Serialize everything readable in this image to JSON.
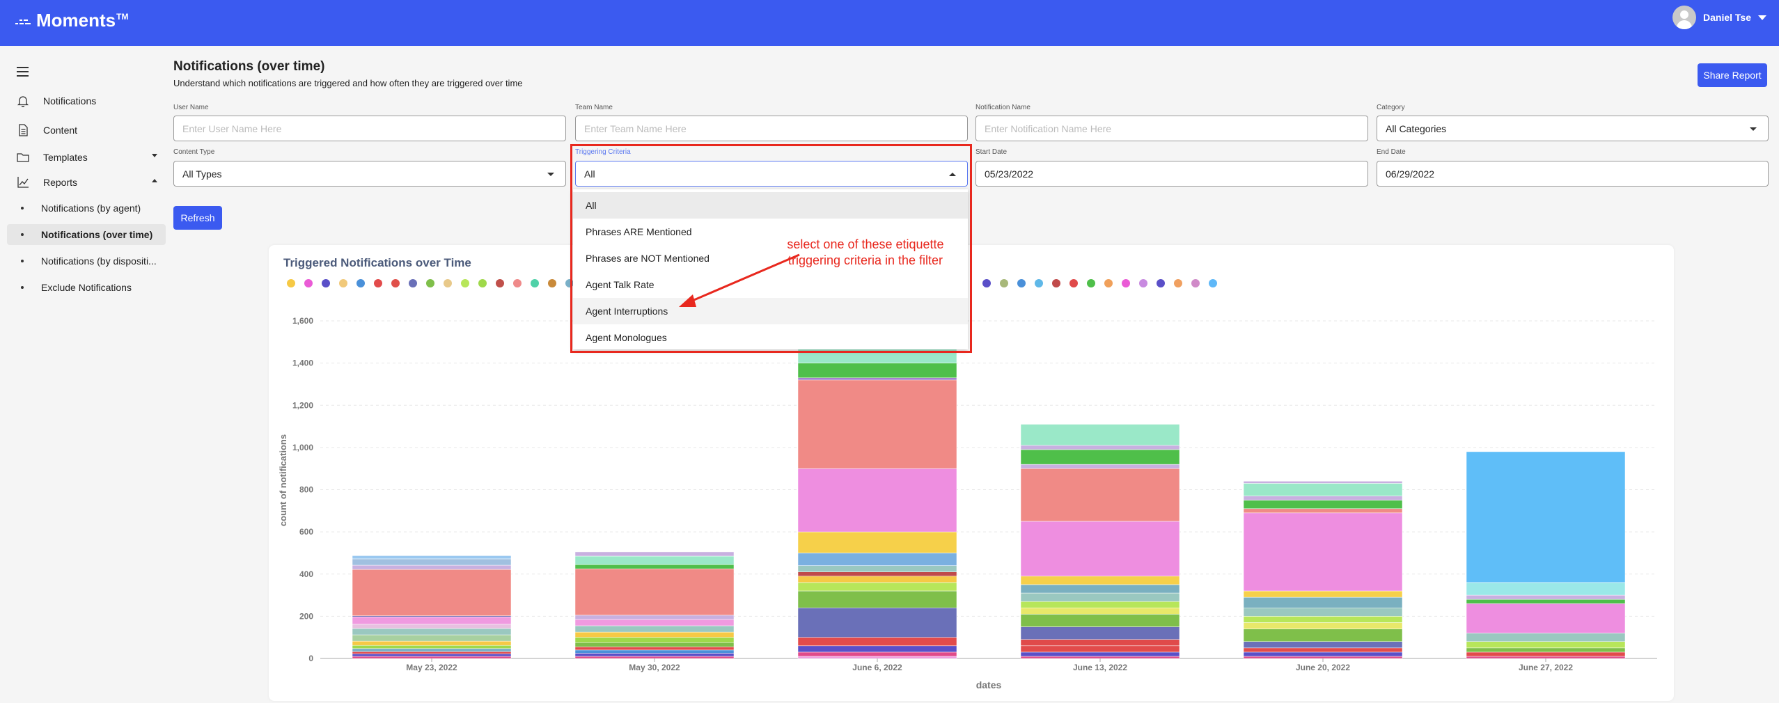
{
  "app": {
    "name": "Moments",
    "trademark": "TM"
  },
  "user": {
    "name": "Daniel Tse"
  },
  "sidebar": {
    "items": [
      {
        "label": "Notifications",
        "icon": "bell-icon"
      },
      {
        "label": "Content",
        "icon": "document-icon"
      },
      {
        "label": "Templates",
        "icon": "folder-icon"
      },
      {
        "label": "Reports",
        "icon": "line-chart-icon"
      }
    ],
    "reports_sub": [
      {
        "label": "Notifications (by agent)"
      },
      {
        "label": "Notifications (over time)"
      },
      {
        "label": "Notifications (by dispositi..."
      },
      {
        "label": "Exclude Notifications"
      }
    ]
  },
  "page": {
    "title": "Notifications (over time)",
    "subtitle": "Understand which notifications are triggered and how often they are triggered over time",
    "share_label": "Share Report",
    "refresh_label": "Refresh"
  },
  "filters": {
    "user_name": {
      "label": "User Name",
      "placeholder": "Enter User Name Here"
    },
    "team_name": {
      "label": "Team Name",
      "placeholder": "Enter Team Name Here"
    },
    "notification_name": {
      "label": "Notification Name",
      "placeholder": "Enter Notification Name Here"
    },
    "category": {
      "label": "Category",
      "value": "All Categories"
    },
    "content_type": {
      "label": "Content Type",
      "value": "All Types"
    },
    "triggering_criteria": {
      "label": "Triggering Criteria",
      "value": "All"
    },
    "start_date": {
      "label": "Start Date",
      "value": "05/23/2022"
    },
    "end_date": {
      "label": "End Date",
      "value": "06/29/2022"
    }
  },
  "dropdown": {
    "options": [
      "All",
      "Phrases ARE Mentioned",
      "Phrases are NOT Mentioned",
      "Agent Talk Rate",
      "Agent Interruptions",
      "Agent Monologues"
    ],
    "selected": "All",
    "hovered": "Agent Interruptions"
  },
  "annotation": {
    "line1": "select one of these etiquette",
    "line2": "triggering criteria in the filter",
    "color": "#e8281e"
  },
  "legend_colors": [
    "#f6c945",
    "#ea5bd6",
    "#5a4fc8",
    "#f1c97a",
    "#4a90d9",
    "#e24b4b",
    "#e0504a",
    "#6a70b8",
    "#7fbf4a",
    "#e8c98a",
    "#b7e65a",
    "#9fd94a",
    "#c0504a",
    "#ef8a8a",
    "#4fd1a8",
    "#c98a3a",
    "#7ab0c8",
    "#5a4fc8",
    "#a8b87a",
    "#4a90d9",
    "#5fb8e8",
    "#c04a4a",
    "#e04a4a",
    "#4fbf4a",
    "#f0a05a",
    "#ea5bd6",
    "#c88ae0",
    "#5a4fc8",
    "#f0a060",
    "#d08ac8",
    "#5fb8f8"
  ],
  "chart_data": {
    "type": "bar",
    "stacked": true,
    "title": "Triggered Notifications over Time",
    "xlabel": "dates",
    "ylabel": "count of notifications",
    "ylim": [
      0,
      1600
    ],
    "yticks": [
      "0",
      "200",
      "400",
      "600",
      "800",
      "1,000",
      "1,200",
      "1,400",
      "1,600"
    ],
    "grid": true,
    "categories": [
      "May 23, 2022",
      "May 30, 2022",
      "June 6, 2022",
      "June 13, 2022",
      "June 20, 2022",
      "June 27, 2022"
    ],
    "segments": [
      [
        {
          "v": 10,
          "c": "#e04a8a"
        },
        {
          "v": 12,
          "c": "#5a4fc8"
        },
        {
          "v": 10,
          "c": "#e24b4b"
        },
        {
          "v": 15,
          "c": "#7ab0c8"
        },
        {
          "v": 15,
          "c": "#9fd94a"
        },
        {
          "v": 20,
          "c": "#f6c945"
        },
        {
          "v": 30,
          "c": "#a8d0a0"
        },
        {
          "v": 30,
          "c": "#9ac8c0"
        },
        {
          "v": 20,
          "c": "#e8c0e0"
        },
        {
          "v": 35,
          "c": "#f09ae0"
        },
        {
          "v": 5,
          "c": "#6a70b8"
        },
        {
          "v": 220,
          "c": "#f08a86"
        },
        {
          "v": 20,
          "c": "#c8b0e0"
        },
        {
          "v": 30,
          "c": "#a0c0e0"
        },
        {
          "v": 15,
          "c": "#9ac8f0"
        }
      ],
      [
        {
          "v": 10,
          "c": "#e04a8a"
        },
        {
          "v": 15,
          "c": "#5a4fc8"
        },
        {
          "v": 15,
          "c": "#4a90d9"
        },
        {
          "v": 15,
          "c": "#e24b4b"
        },
        {
          "v": 20,
          "c": "#7fbf4a"
        },
        {
          "v": 25,
          "c": "#9fd94a"
        },
        {
          "v": 25,
          "c": "#f6c945"
        },
        {
          "v": 30,
          "c": "#9ac8c0"
        },
        {
          "v": 30,
          "c": "#f09ae0"
        },
        {
          "v": 20,
          "c": "#c8b0e0"
        },
        {
          "v": 220,
          "c": "#f08a86"
        },
        {
          "v": 20,
          "c": "#4fbf4a"
        },
        {
          "v": 40,
          "c": "#9ae8c8"
        },
        {
          "v": 20,
          "c": "#c8b0e0"
        }
      ],
      [
        {
          "v": 10,
          "c": "#f09ae0"
        },
        {
          "v": 20,
          "c": "#e04a8a"
        },
        {
          "v": 30,
          "c": "#5a4fc8"
        },
        {
          "v": 40,
          "c": "#e24b4b"
        },
        {
          "v": 140,
          "c": "#6a70b8"
        },
        {
          "v": 80,
          "c": "#7fbf4a"
        },
        {
          "v": 40,
          "c": "#b7e65a"
        },
        {
          "v": 30,
          "c": "#f6c945"
        },
        {
          "v": 20,
          "c": "#c04a4a"
        },
        {
          "v": 30,
          "c": "#9ac8c0"
        },
        {
          "v": 60,
          "c": "#7ab0e0"
        },
        {
          "v": 100,
          "c": "#f6d04a"
        },
        {
          "v": 300,
          "c": "#ee8ee0"
        },
        {
          "v": 420,
          "c": "#f08a86"
        },
        {
          "v": 10,
          "c": "#9a70c8"
        },
        {
          "v": 70,
          "c": "#4fbf4a"
        },
        {
          "v": 400,
          "c": "#9ae8c8"
        }
      ],
      [
        {
          "v": 10,
          "c": "#e04a8a"
        },
        {
          "v": 20,
          "c": "#5a4fc8"
        },
        {
          "v": 30,
          "c": "#e24b4b"
        },
        {
          "v": 30,
          "c": "#e04a4a"
        },
        {
          "v": 60,
          "c": "#6a70b8"
        },
        {
          "v": 60,
          "c": "#7fbf4a"
        },
        {
          "v": 30,
          "c": "#e8e86a"
        },
        {
          "v": 30,
          "c": "#b7e65a"
        },
        {
          "v": 40,
          "c": "#9ac8c0"
        },
        {
          "v": 40,
          "c": "#7ab0c0"
        },
        {
          "v": 40,
          "c": "#f6d04a"
        },
        {
          "v": 260,
          "c": "#ee8ee0"
        },
        {
          "v": 250,
          "c": "#f08a86"
        },
        {
          "v": 20,
          "c": "#c8b0e0"
        },
        {
          "v": 70,
          "c": "#4fbf4a"
        },
        {
          "v": 20,
          "c": "#c8b0e0"
        },
        {
          "v": 100,
          "c": "#9ae8c8"
        }
      ],
      [
        {
          "v": 10,
          "c": "#e04a8a"
        },
        {
          "v": 20,
          "c": "#5a4fc8"
        },
        {
          "v": 20,
          "c": "#e24b4b"
        },
        {
          "v": 30,
          "c": "#6a70b8"
        },
        {
          "v": 60,
          "c": "#7fbf4a"
        },
        {
          "v": 30,
          "c": "#e8e86a"
        },
        {
          "v": 30,
          "c": "#b7e65a"
        },
        {
          "v": 40,
          "c": "#9ac8c0"
        },
        {
          "v": 50,
          "c": "#7ab0c0"
        },
        {
          "v": 30,
          "c": "#f6d04a"
        },
        {
          "v": 370,
          "c": "#ee8ee0"
        },
        {
          "v": 20,
          "c": "#f08a86"
        },
        {
          "v": 40,
          "c": "#4fbf4a"
        },
        {
          "v": 20,
          "c": "#c8b0e0"
        },
        {
          "v": 60,
          "c": "#9ae8c8"
        },
        {
          "v": 10,
          "c": "#c8b0e0"
        }
      ],
      [
        {
          "v": 10,
          "c": "#e04a8a"
        },
        {
          "v": 20,
          "c": "#e24b4b"
        },
        {
          "v": 20,
          "c": "#7fbf4a"
        },
        {
          "v": 30,
          "c": "#b7e65a"
        },
        {
          "v": 40,
          "c": "#9ac8c0"
        },
        {
          "v": 140,
          "c": "#ee8ee0"
        },
        {
          "v": 20,
          "c": "#4fbf4a"
        },
        {
          "v": 20,
          "c": "#c8b0e0"
        },
        {
          "v": 60,
          "c": "#9ae8e8"
        },
        {
          "v": 620,
          "c": "#5fbef8"
        }
      ]
    ]
  }
}
